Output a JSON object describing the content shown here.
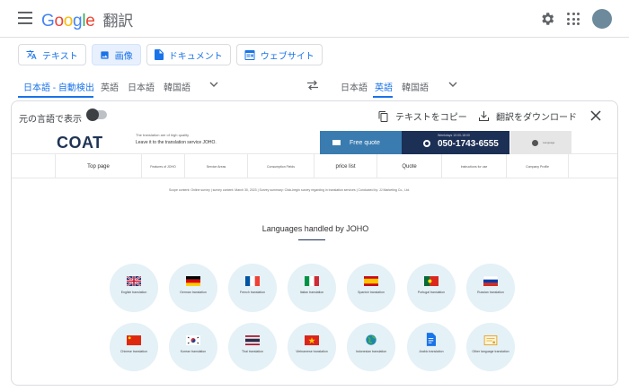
{
  "app": {
    "logo_letters": [
      "G",
      "o",
      "o",
      "g",
      "l",
      "e"
    ],
    "product": "翻訳"
  },
  "modes": [
    {
      "label": "テキスト",
      "icon": "translate-icon"
    },
    {
      "label": "画像",
      "icon": "image-icon",
      "active": true
    },
    {
      "label": "ドキュメント",
      "icon": "document-icon"
    },
    {
      "label": "ウェブサイト",
      "icon": "website-icon"
    }
  ],
  "source_langs": [
    "日本語 - 自動検出",
    "英語",
    "日本語",
    "韓国語"
  ],
  "target_langs": [
    "日本語",
    "英語",
    "韓国語"
  ],
  "panel": {
    "toggle_label": "元の言語で表示",
    "copy_label": "テキストをコピー",
    "download_label": "翻訳をダウンロード"
  },
  "site": {
    "logo": "COAT",
    "tagline_1": "The translation are of high quality",
    "tagline_2": "Leave it to the translation service JOHO.",
    "quote_label": "Free quote",
    "phone_hours": "Weekdays 10:00-18:00",
    "phone": "050-1743-6555",
    "globe_label": "Language",
    "nav": [
      "Top page",
      "Features of JOHO",
      "Service Areas",
      "Consumption Fields",
      "price list",
      "Quote",
      "Instructions for use",
      "Company Profile"
    ],
    "breadcrumb": "Scope content: Online survey | survey content: March 30, 2023 | Survey summary: Click-begin survey regarding  in translation services | Conducted by: JJ Marketing Co., Ltd.",
    "section_title": "Languages handled by JOHO",
    "languages_row1": [
      "English translation",
      "German translation",
      "French translation",
      "Italian translation",
      "Spanish translation",
      "Portugal translation",
      "Russian translation"
    ],
    "languages_row2": [
      "Chinese translation",
      "Korean translation",
      "Thai translation",
      "Vietnamese translation",
      "Indonesian translation",
      "Arabic translation",
      "Other language translation"
    ]
  }
}
